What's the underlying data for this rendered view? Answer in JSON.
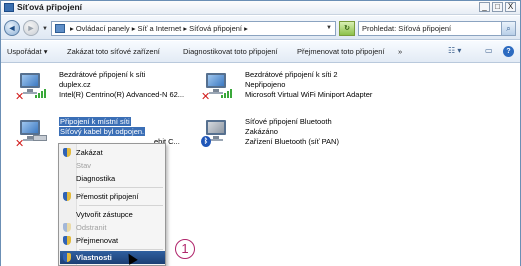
{
  "window": {
    "title": "Síťová připojení",
    "controls": [
      "_",
      "□",
      "X"
    ]
  },
  "address": {
    "path": "▸ Ovládací panely ▸ Síť a Internet ▸ Síťová připojení ▸",
    "search_placeholder": "Prohledat: Síťová připojení"
  },
  "commands": {
    "organize": "Uspořádat",
    "disable": "Zakázat toto síťové zařízení",
    "diagnose": "Diagnostikovat toto připojení",
    "rename": "Přejmenovat toto připojení",
    "more": "»"
  },
  "connections": [
    {
      "name": "Bezdrátové připojení k síti",
      "status": "duplex.cz",
      "device": "Intel(R) Centrino(R) Advanced-N 62..."
    },
    {
      "name": "Bezdrátové připojení k síti 2",
      "status": "Nepřipojeno",
      "device": "Microsoft Virtual WiFi Miniport Adapter"
    },
    {
      "name": "Připojení k místní síti",
      "status": "Síťový kabel byl odpojen.",
      "device": "ebit C..."
    },
    {
      "name": "Síťové připojení Bluetooth",
      "status": "Zakázáno",
      "device": "Zařízení Bluetooth (síť PAN)"
    }
  ],
  "context_menu": {
    "items": [
      {
        "label": "Zakázat",
        "shield": true,
        "disabled": false
      },
      {
        "label": "Stav",
        "shield": false,
        "disabled": true
      },
      {
        "label": "Diagnostika",
        "shield": false,
        "disabled": false
      },
      {
        "label": "Přemostit připojení",
        "shield": true,
        "disabled": false
      },
      {
        "label": "Vytvořit zástupce",
        "shield": false,
        "disabled": false
      },
      {
        "label": "Odstranit",
        "shield": true,
        "disabled": true
      },
      {
        "label": "Přejmenovat",
        "shield": true,
        "disabled": false
      },
      {
        "label": "Vlastnosti",
        "shield": true,
        "disabled": false,
        "highlighted": true
      }
    ]
  },
  "callout": {
    "number": "1"
  },
  "colors": {
    "selection": "#3b6fb6",
    "callout": "#b0256b",
    "menu_highlight": "#1c3f74"
  }
}
